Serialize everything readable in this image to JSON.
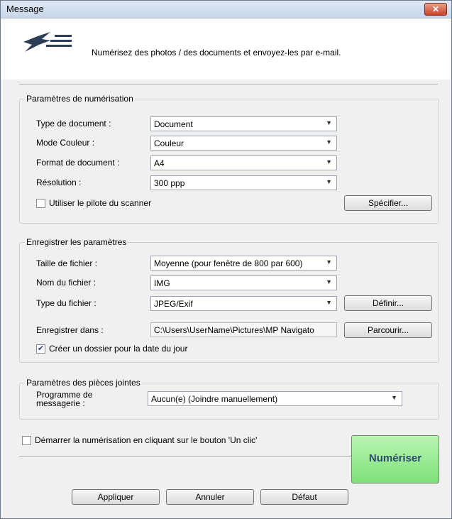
{
  "window": {
    "title": "Message"
  },
  "header": {
    "description": "Numérisez des photos / des documents et envoyez-les par e-mail."
  },
  "scan_settings": {
    "title": "Paramètres de numérisation",
    "doc_type": {
      "label": "Type de document :",
      "value": "Document"
    },
    "color_mode": {
      "label": "Mode Couleur :",
      "value": "Couleur"
    },
    "doc_size": {
      "label": "Format de document :",
      "value": "A4"
    },
    "resolution": {
      "label": "Résolution :",
      "value": "300 ppp"
    },
    "use_driver": {
      "label": "Utiliser le pilote du scanner",
      "checked": false
    },
    "specify_button": "Spécifier..."
  },
  "save_settings": {
    "title": "Enregistrer les paramètres",
    "file_size": {
      "label": "Taille de fichier :",
      "value": "Moyenne (pour fenêtre de 800 par 600)"
    },
    "file_name": {
      "label": "Nom du fichier :",
      "value": "IMG"
    },
    "file_type": {
      "label": "Type du fichier :",
      "value": "JPEG/Exif"
    },
    "define_button": "Définir...",
    "save_in": {
      "label": "Enregistrer dans :",
      "value": "C:\\Users\\UserName\\Pictures\\MP Navigato"
    },
    "browse_button": "Parcourir...",
    "create_folder": {
      "label": "Créer un dossier pour la date du jour",
      "checked": true
    }
  },
  "attachment_settings": {
    "title": "Paramètres des pièces jointes",
    "mail_program": {
      "label_line1": "Programme de",
      "label_line2": "messagerie :",
      "value": "Aucun(e) (Joindre manuellement)"
    }
  },
  "one_click": {
    "label": "Démarrer la numérisation en cliquant sur le bouton 'Un clic'",
    "checked": false
  },
  "buttons": {
    "apply": "Appliquer",
    "cancel": "Annuler",
    "default": "Défaut",
    "scan": "Numériser"
  }
}
